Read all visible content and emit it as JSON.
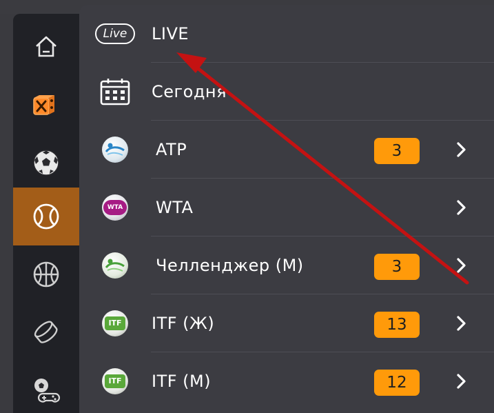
{
  "sidebar": {
    "items": [
      {
        "id": "home",
        "icon": "home-icon"
      },
      {
        "id": "casino",
        "icon": "dice-icon",
        "color": "#ff8a2a"
      },
      {
        "id": "football",
        "icon": "soccer-ball-icon"
      },
      {
        "id": "tennis",
        "icon": "tennis-ball-icon",
        "active": true
      },
      {
        "id": "basketball",
        "icon": "basketball-icon"
      },
      {
        "id": "hockey",
        "icon": "hockey-puck-icon"
      },
      {
        "id": "esports",
        "icon": "gamepad-ball-icon"
      }
    ],
    "active_color": "#a35d18"
  },
  "menu": {
    "live": {
      "badge": "Live",
      "label": "LIVE"
    },
    "today": {
      "label": "Сегодня",
      "icon": "calendar-icon"
    },
    "rows": [
      {
        "label": "ATP",
        "count": "3",
        "icon": "atp-logo-icon"
      },
      {
        "label": "WTA",
        "count": "",
        "icon": "wta-logo-icon",
        "logo_text": "WTA"
      },
      {
        "label": "Челленджер (М)",
        "count": "3",
        "icon": "challenger-logo-icon"
      },
      {
        "label": "ITF (Ж)",
        "count": "13",
        "icon": "itf-logo-icon",
        "logo_text": "ITF"
      },
      {
        "label": "ITF (М)",
        "count": "12",
        "icon": "itf-logo-icon",
        "logo_text": "ITF"
      }
    ]
  },
  "colors": {
    "accent": "#ff9a0a",
    "annotation_arrow": "#c41212"
  }
}
